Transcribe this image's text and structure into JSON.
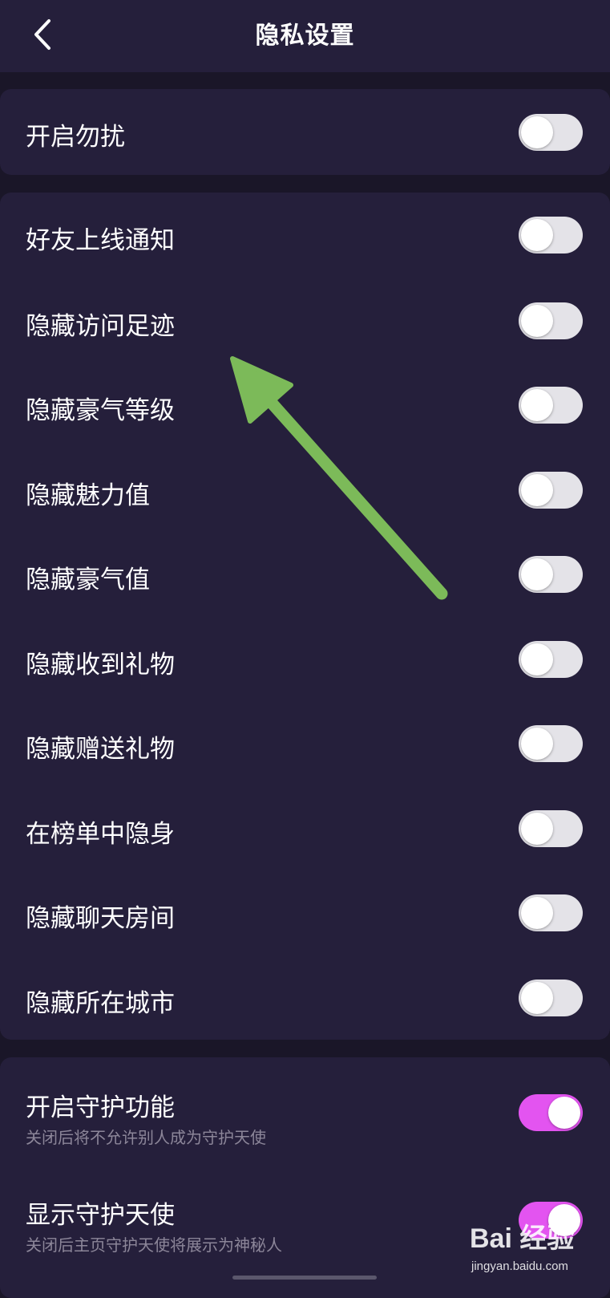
{
  "header": {
    "title": "隐私设置",
    "back_icon": "chevron-left-icon"
  },
  "colors": {
    "background": "#1a1628",
    "card": "#251f3b",
    "toggle_off": "#e4e3e8",
    "toggle_on": "#e354f0",
    "annotation_arrow": "#7cba59"
  },
  "section_dnd": {
    "items": [
      {
        "label": "开启勿扰",
        "on": false
      }
    ]
  },
  "section_privacy": {
    "items": [
      {
        "label": "好友上线通知",
        "on": false
      },
      {
        "label": "隐藏访问足迹",
        "on": false
      },
      {
        "label": "隐藏豪气等级",
        "on": false
      },
      {
        "label": "隐藏魅力值",
        "on": false
      },
      {
        "label": "隐藏豪气值",
        "on": false
      },
      {
        "label": "隐藏收到礼物",
        "on": false
      },
      {
        "label": "隐藏赠送礼物",
        "on": false
      },
      {
        "label": "在榜单中隐身",
        "on": false
      },
      {
        "label": "隐藏聊天房间",
        "on": false
      },
      {
        "label": "隐藏所在城市",
        "on": false
      }
    ]
  },
  "section_guard": {
    "items": [
      {
        "label": "开启守护功能",
        "sub": "关闭后将不允许别人成为守护天使",
        "on": true
      },
      {
        "label": "显示守护天使",
        "sub": "关闭后主页守护天使将展示为神秘人",
        "on": true
      }
    ]
  },
  "watermark": {
    "logo": "Bai 经验",
    "url": "jingyan.baidu.com"
  }
}
